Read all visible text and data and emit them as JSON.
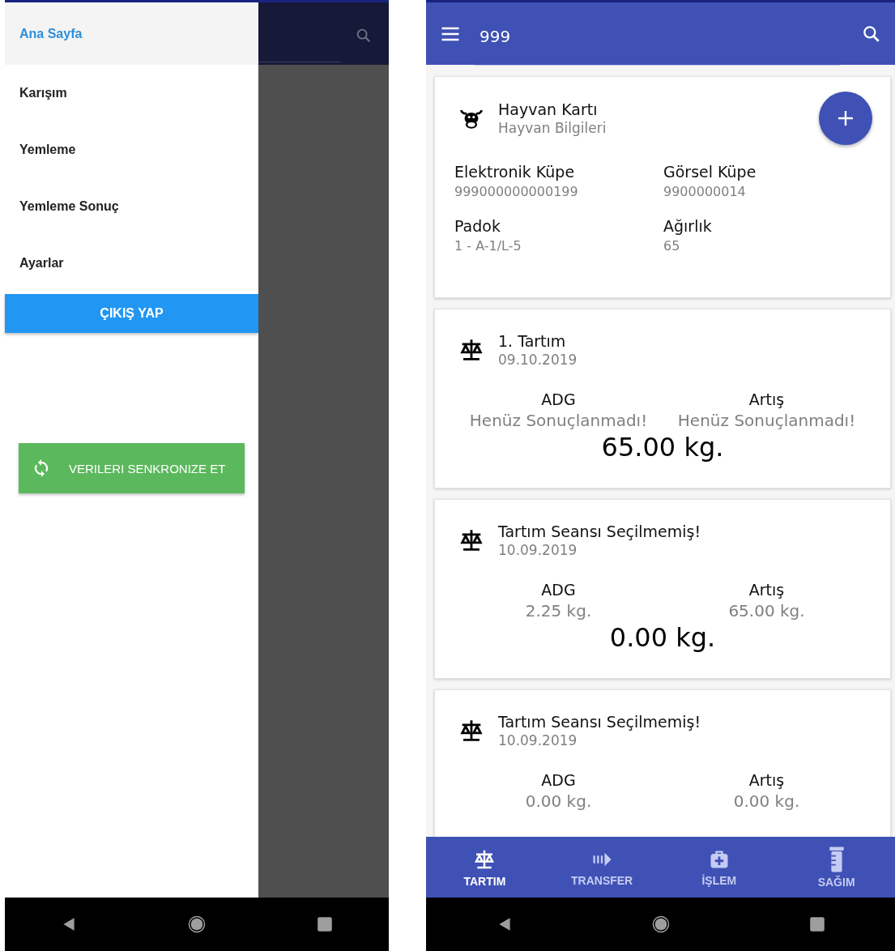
{
  "left_phone": {
    "drawer": {
      "items": [
        {
          "label": "Ana Sayfa",
          "selected": true
        },
        {
          "label": "Karışım",
          "selected": false
        },
        {
          "label": "Yemleme",
          "selected": false
        },
        {
          "label": "Yemleme Sonuç",
          "selected": false
        },
        {
          "label": "Ayarlar",
          "selected": false
        }
      ],
      "logout_button": "ÇIKIŞ YAP",
      "sync_button": "VERILERI SENKRONIZE ET"
    }
  },
  "right_phone": {
    "search": {
      "value": "999"
    },
    "animal_card": {
      "title": "Hayvan Kartı",
      "subtitle": "Hayvan Bilgileri",
      "fields": [
        {
          "label": "Elektronik Küpe",
          "value": "999000000000199"
        },
        {
          "label": "Görsel Küpe",
          "value": "9900000014"
        },
        {
          "label": "Padok",
          "value": "1 - A-1/L-5"
        },
        {
          "label": "Ağırlık",
          "value": "65"
        }
      ]
    },
    "weighings": [
      {
        "title": "1. Tartım",
        "date": "09.10.2019",
        "adg_label": "ADG",
        "adg_value": "Henüz Sonuçlanmadı!",
        "gain_label": "Artış",
        "gain_value": "Henüz Sonuçlanmadı!",
        "total": "65.00 kg."
      },
      {
        "title": "Tartım Seansı Seçilmemiş!",
        "date": "10.09.2019",
        "adg_label": "ADG",
        "adg_value": "2.25 kg.",
        "gain_label": "Artış",
        "gain_value": "65.00 kg.",
        "total": "0.00 kg."
      },
      {
        "title": "Tartım Seansı Seçilmemiş!",
        "date": "10.09.2019",
        "adg_label": "ADG",
        "adg_value": "0.00 kg.",
        "gain_label": "Artış",
        "gain_value": "0.00 kg."
      }
    ],
    "bottom_tabs": [
      {
        "label": "TARTIM",
        "kind": "scale",
        "selected": true
      },
      {
        "label": "TRANSFER",
        "kind": "transfer",
        "selected": false
      },
      {
        "label": "İŞLEM",
        "kind": "medkit",
        "selected": false
      },
      {
        "label": "SAĞIM",
        "kind": "jar",
        "selected": false
      }
    ]
  }
}
